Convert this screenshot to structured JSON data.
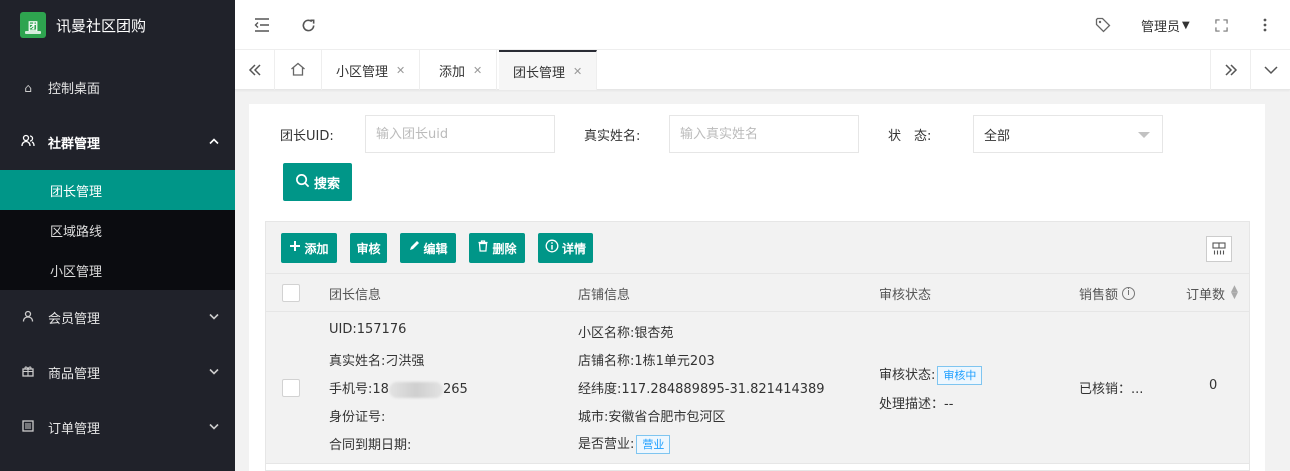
{
  "brand": {
    "name": "讯曼社区团购",
    "logo_text": "团"
  },
  "sidebar": {
    "items": [
      {
        "label": "控制桌面",
        "icon": "home-icon"
      },
      {
        "label": "社群管理",
        "icon": "group-icon",
        "open": true,
        "children": [
          {
            "label": "团长管理",
            "active": true
          },
          {
            "label": "区域路线"
          },
          {
            "label": "小区管理"
          }
        ]
      },
      {
        "label": "会员管理",
        "icon": "user-icon"
      },
      {
        "label": "商品管理",
        "icon": "gift-icon"
      },
      {
        "label": "订单管理",
        "icon": "list-icon"
      }
    ]
  },
  "header": {
    "user": "管理员"
  },
  "tabs": [
    {
      "label": "小区管理"
    },
    {
      "label": "添加"
    },
    {
      "label": "团长管理",
      "active": true
    }
  ],
  "filters": {
    "uid_label": "团长UID:",
    "uid_placeholder": "输入团长uid",
    "name_label": "真实姓名:",
    "name_placeholder": "输入真实姓名",
    "status_label": "状　态:",
    "status_value": "全部",
    "search_label": "搜索"
  },
  "toolbar": {
    "add": "添加",
    "audit": "审核",
    "edit": "编辑",
    "delete": "删除",
    "detail": "详情"
  },
  "table": {
    "columns": [
      "团长信息",
      "店铺信息",
      "审核状态",
      "销售额",
      "订单数"
    ],
    "rows": [
      {
        "leader": {
          "uid": "UID:157176",
          "name": "真实姓名:刁洪强",
          "phone_prefix": "手机号:18",
          "phone_suffix": "265",
          "id_card": "身份证号:",
          "contract": "合同到期日期:"
        },
        "shop": {
          "community": "小区名称:银杏苑",
          "shop_name": "店铺名称:1栋1单元203",
          "coords": "经纬度:117.284889895-31.821414389",
          "city": "城市:安徽省合肥市包河区",
          "open_label": "是否营业:",
          "open_badge": "营业"
        },
        "audit": {
          "status_label": "审核状态:",
          "status_badge": "审核中",
          "desc": "处理描述：--"
        },
        "sales": "已核销：...",
        "orders": "0"
      }
    ]
  },
  "colors": {
    "primary": "#009688",
    "sidebar_bg": "#20222a",
    "badge_blue": "#1e9fff"
  }
}
